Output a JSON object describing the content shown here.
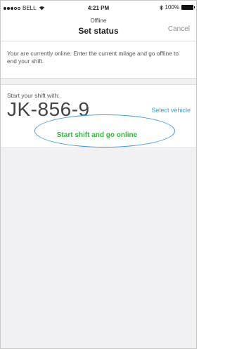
{
  "status_bar": {
    "carrier": "BELL",
    "time": "4:21 PM",
    "battery_percent": "100%",
    "signal_bars_filled": 3,
    "signal_bars_total": 5
  },
  "nav": {
    "subtitle": "Offline",
    "title": "Set status",
    "cancel_label": "Cancel"
  },
  "info": {
    "text": "Your are currently online. Enter the current milage and go offline to end your shift."
  },
  "shift": {
    "label": "Start your shift with:",
    "vehicle_plate": "JK-856-9",
    "select_vehicle_label": "Select vehicle"
  },
  "action": {
    "start_label": "Start shift and go online"
  },
  "colors": {
    "accent_green": "#33b540",
    "link_blue": "#2fa4e0",
    "highlight_blue": "#3a9bd5"
  }
}
